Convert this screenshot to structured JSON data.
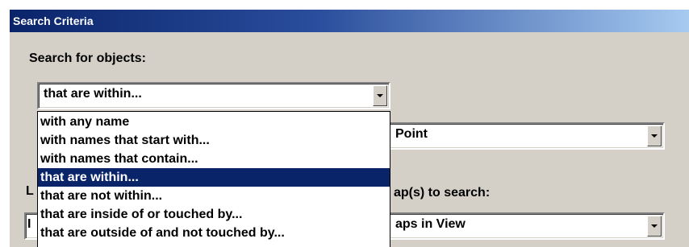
{
  "window": {
    "title": "Search Criteria"
  },
  "search_for": {
    "label": "Search for objects:",
    "selected": "that are within..."
  },
  "dropdown": {
    "options": [
      "with any name",
      "with names that start with...",
      "with names that contain...",
      "that are within...",
      "that are not within...",
      "that are inside of or touched by...",
      "that are outside of and not touched by..."
    ],
    "highlighted_index": 3
  },
  "right_combo_1": {
    "value": "Point"
  },
  "maps_to_search": {
    "label": "ap(s) to search:",
    "value": "aps in View"
  },
  "partial_left_label": "L",
  "partial_left_input": "I",
  "colors": {
    "selection": "#0a246a",
    "titlebar_start": "#0a246a",
    "titlebar_end": "#a6caf0",
    "dialog_face": "#d4d0c8"
  },
  "icons": {
    "combo_arrow": "chevron-down-icon"
  }
}
